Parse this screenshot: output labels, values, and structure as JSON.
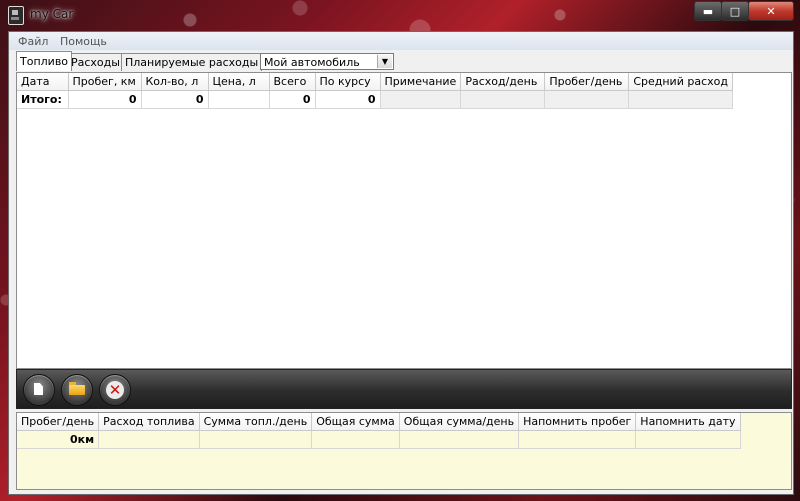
{
  "window": {
    "title": "my Car"
  },
  "menu": {
    "items": [
      "Файл",
      "Помощь"
    ]
  },
  "tabs": [
    "Топливо",
    "Расходы",
    "Планируемые расходы"
  ],
  "vehicle_select": {
    "value": "Мой автомобиль"
  },
  "fuel_table": {
    "headers": [
      "Дата",
      "Пробег, км",
      "Кол-во, л",
      "Цена, л",
      "Всего",
      "По курсу",
      "Примечание",
      "Расход/день",
      "Пробег/день",
      "Средний расход"
    ],
    "totals": [
      "Итого:",
      "0",
      "0",
      "",
      "0",
      "0",
      "",
      "",
      "",
      ""
    ]
  },
  "toolbar": {
    "buttons": [
      "new-document-icon",
      "open-folder-icon",
      "delete-icon"
    ]
  },
  "summary_table": {
    "headers": [
      "Пробег/день",
      "Расход топлива",
      "Сумма топл./день",
      "Общая сумма",
      "Общая сумма/день",
      "Напомнить пробег",
      "Напомнить дату"
    ],
    "row": [
      "0км",
      "",
      "",
      "",
      "",
      "",
      ""
    ]
  },
  "colors": {
    "summary_background": "#fbfbdc",
    "toolbar": "#2d2d2d",
    "close_button": "#c0392b"
  }
}
